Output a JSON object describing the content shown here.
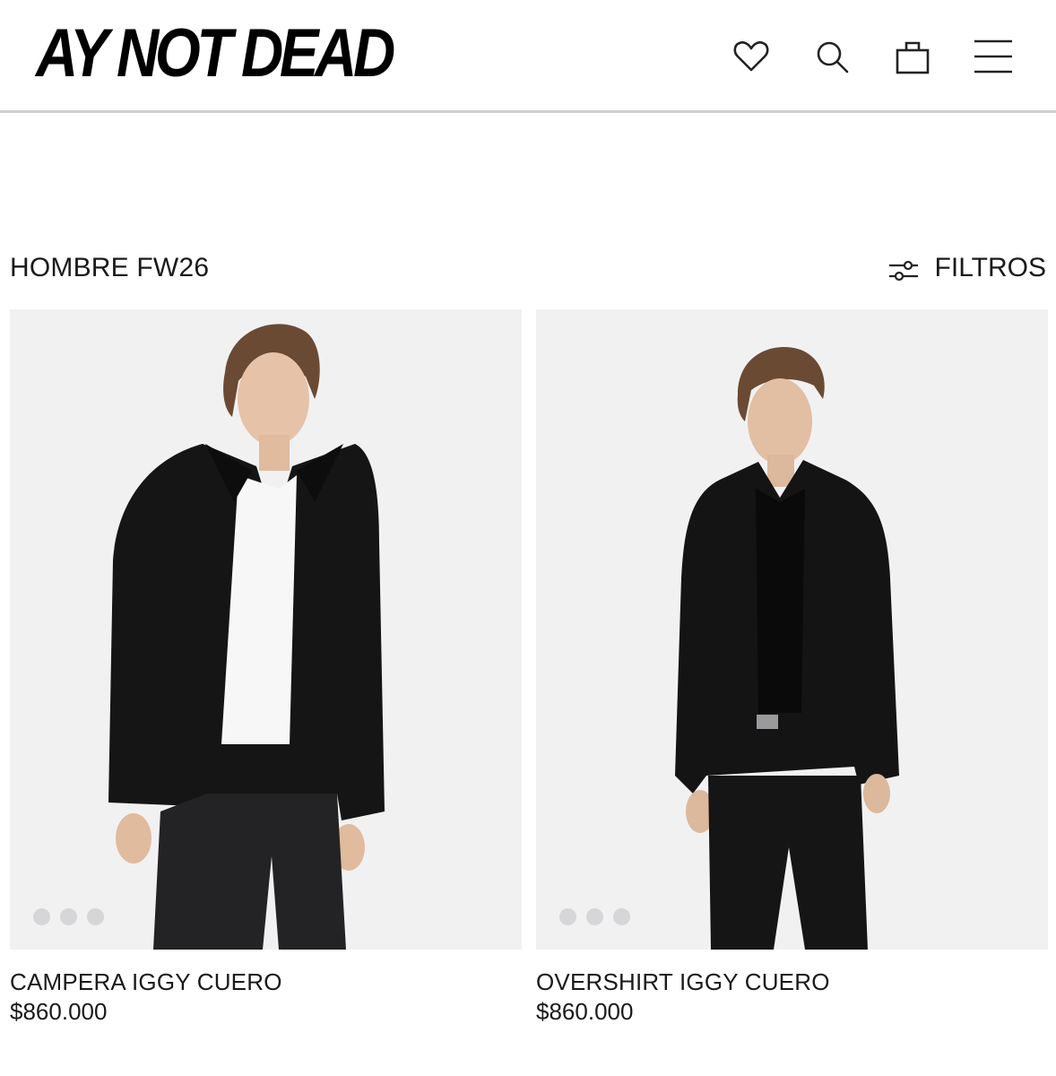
{
  "header": {
    "logo_text": "AY NOT DEAD",
    "icons": [
      "heart-icon",
      "search-icon",
      "shopping-bag-icon",
      "menu-icon"
    ]
  },
  "listing": {
    "title": "HOMBRE FW26",
    "filters_label": "FILTROS"
  },
  "products": [
    {
      "name": "CAMPERA IGGY CUERO",
      "price": "$860.000",
      "image_dots": 3
    },
    {
      "name": "OVERSHIRT IGGY CUERO",
      "price": "$860.000",
      "image_dots": 3
    }
  ],
  "colors": {
    "text": "#1a1a1a",
    "photo_background": "#f1f1f2",
    "dot": "#d6d6d8",
    "header_border": "#cfcfcf"
  }
}
